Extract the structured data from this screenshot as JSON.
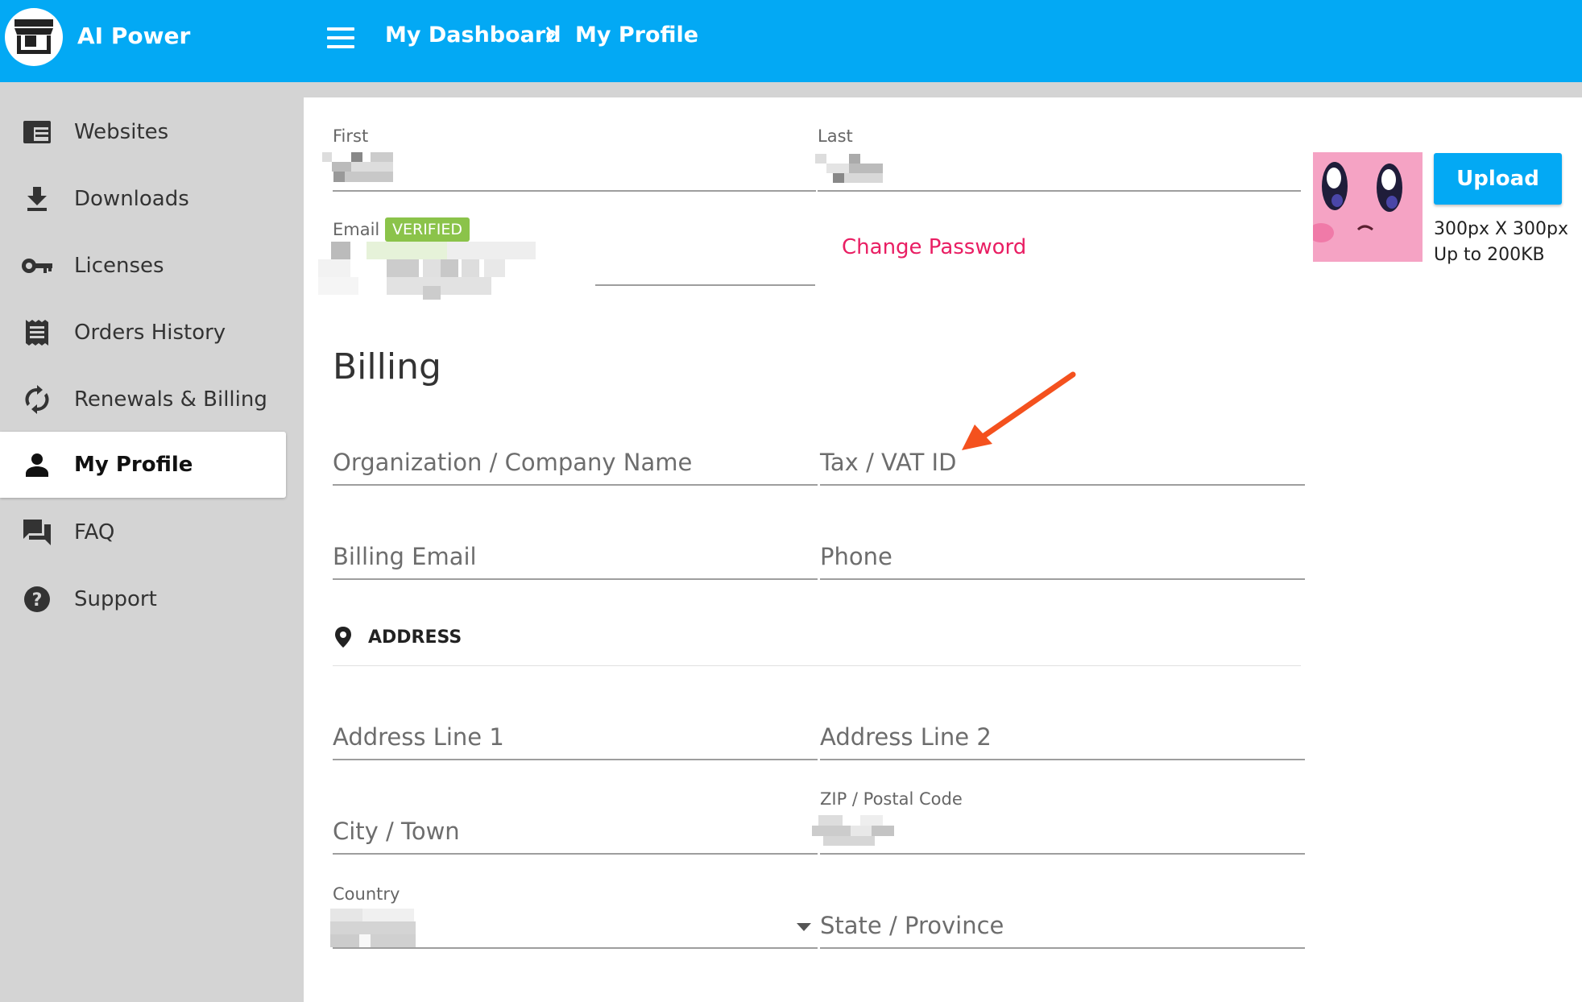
{
  "header": {
    "app_title": "AI Power",
    "logo_icon": "storefront-icon",
    "menu_icon": "hamburger-menu-icon",
    "breadcrumb": [
      "My Dashboard",
      "My Profile"
    ],
    "accent_color": "#03a9f4"
  },
  "sidebar": {
    "items": [
      {
        "label": "Websites",
        "icon": "website-icon",
        "active": false
      },
      {
        "label": "Downloads",
        "icon": "download-icon",
        "active": false
      },
      {
        "label": "Licenses",
        "icon": "key-icon",
        "active": false
      },
      {
        "label": "Orders History",
        "icon": "receipt-icon",
        "active": false
      },
      {
        "label": "Renewals & Billing",
        "icon": "sync-icon",
        "active": false
      },
      {
        "label": "My Profile",
        "icon": "person-icon",
        "active": true
      },
      {
        "label": "FAQ",
        "icon": "forum-icon",
        "active": false
      },
      {
        "label": "Support",
        "icon": "help-icon",
        "active": false
      }
    ]
  },
  "profile": {
    "first_label": "First",
    "last_label": "Last",
    "email_label": "Email",
    "verified_badge": "VERIFIED",
    "change_password": "Change Password",
    "upload_button": "Upload",
    "avatar_size_note": "300px X 300px",
    "avatar_limit_note": "Up to 200KB"
  },
  "billing": {
    "heading": "Billing",
    "company_placeholder": "Organization / Company Name",
    "tax_placeholder": "Tax / VAT ID",
    "billing_email_placeholder": "Billing Email",
    "phone_placeholder": "Phone",
    "address_label": "ADDRESS",
    "address_icon": "map-pin-icon",
    "address1_placeholder": "Address Line 1",
    "address2_placeholder": "Address Line 2",
    "city_placeholder": "City / Town",
    "zip_label": "ZIP / Postal Code",
    "country_label": "Country",
    "state_placeholder": "State / Province"
  },
  "annotation": {
    "icon": "red-arrow-icon",
    "color": "#f4511e"
  },
  "colors": {
    "verified": "#8bc34a",
    "change_password": "#e91e63"
  }
}
